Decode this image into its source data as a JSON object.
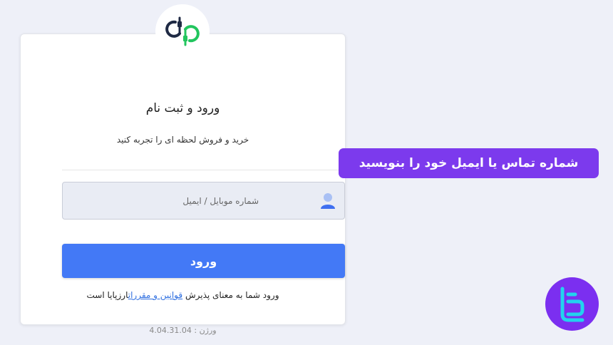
{
  "login": {
    "title": "ورود و ثبت نام",
    "subtitle": "خرید و فروش لحظه ای را تجربه کنید",
    "input_placeholder": "شماره موبایل / ایمیل",
    "submit_label": "ورود",
    "terms_prefix": "ورود شما به معنای پذیرش",
    "terms_link": "قوانین و مقررات",
    "terms_suffix": "ارزپایا است",
    "version_label": "ورژن :",
    "version_value": "4.04.31.04"
  },
  "callout": {
    "text": "شماره تماس یا ایمیل خود را بنویسید"
  },
  "icons": {
    "logo": "arzpaya-logo-icon",
    "user": "user-icon",
    "brand": "brand-badge-icon"
  },
  "colors": {
    "page_bg": "#eef0f8",
    "primary_button": "#4379f6",
    "link": "#2f6fe0",
    "callout_bg": "#7c3aed",
    "badge_bg": "#7b2ff0",
    "badge_accent": "#22d3ee",
    "logo_dark": "#1f2a44",
    "logo_green": "#22c55e"
  }
}
